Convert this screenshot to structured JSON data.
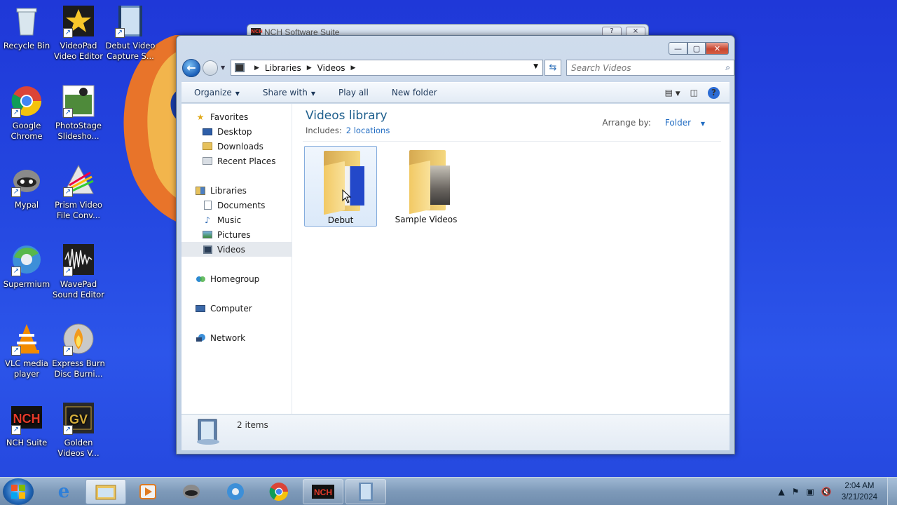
{
  "desktop": {
    "icons": [
      {
        "label": "Recycle Bin",
        "icon": "recycle-bin-icon"
      },
      {
        "label": "VideoPad Video Editor",
        "icon": "videopad-icon"
      },
      {
        "label": "Debut Video Capture S...",
        "icon": "debut-icon"
      },
      {
        "label": "Google Chrome",
        "icon": "chrome-icon"
      },
      {
        "label": "PhotoStage Slidesho...",
        "icon": "photostage-icon"
      },
      {
        "label": "Mypal",
        "icon": "mypal-icon"
      },
      {
        "label": "Prism Video File Conv...",
        "icon": "prism-icon"
      },
      {
        "label": "Supermium",
        "icon": "supermium-icon"
      },
      {
        "label": "WavePad Sound Editor",
        "icon": "wavepad-icon"
      },
      {
        "label": "VLC media player",
        "icon": "vlc-icon"
      },
      {
        "label": "Express Burn Disc Burni...",
        "icon": "expressburn-icon"
      },
      {
        "label": "NCH Suite",
        "icon": "nch-icon"
      },
      {
        "label": "Golden Videos V...",
        "icon": "goldenvideos-icon"
      }
    ]
  },
  "background_window": {
    "title": "NCH Software Suite",
    "help": "?",
    "close": "×"
  },
  "explorer": {
    "caption": {
      "minimize": "—",
      "maximize": "▢",
      "close": "✕"
    },
    "address": {
      "crumbs": [
        "Libraries",
        "Videos"
      ]
    },
    "search": {
      "placeholder": "Search Videos"
    },
    "toolbar": {
      "organize": "Organize",
      "share_with": "Share with",
      "play_all": "Play all",
      "new_folder": "New folder"
    },
    "nav": {
      "favorites": "Favorites",
      "desktop": "Desktop",
      "downloads": "Downloads",
      "recent_places": "Recent Places",
      "libraries": "Libraries",
      "documents": "Documents",
      "music": "Music",
      "pictures": "Pictures",
      "videos": "Videos",
      "homegroup": "Homegroup",
      "computer": "Computer",
      "network": "Network"
    },
    "library": {
      "title": "Videos library",
      "includes_label": "Includes:",
      "includes_link": "2 locations",
      "arrange_label": "Arrange by:",
      "arrange_value": "Folder"
    },
    "items": [
      {
        "name": "Debut",
        "selected": true
      },
      {
        "name": "Sample Videos",
        "selected": false
      }
    ],
    "status": {
      "count": "2 items"
    }
  },
  "taskbar": {
    "clock_time": "2:04 AM",
    "clock_date": "3/21/2024"
  },
  "colors": {
    "desktop": "#2447e0",
    "accent": "#1f6bc2",
    "title_green": "#1e5f8d"
  }
}
